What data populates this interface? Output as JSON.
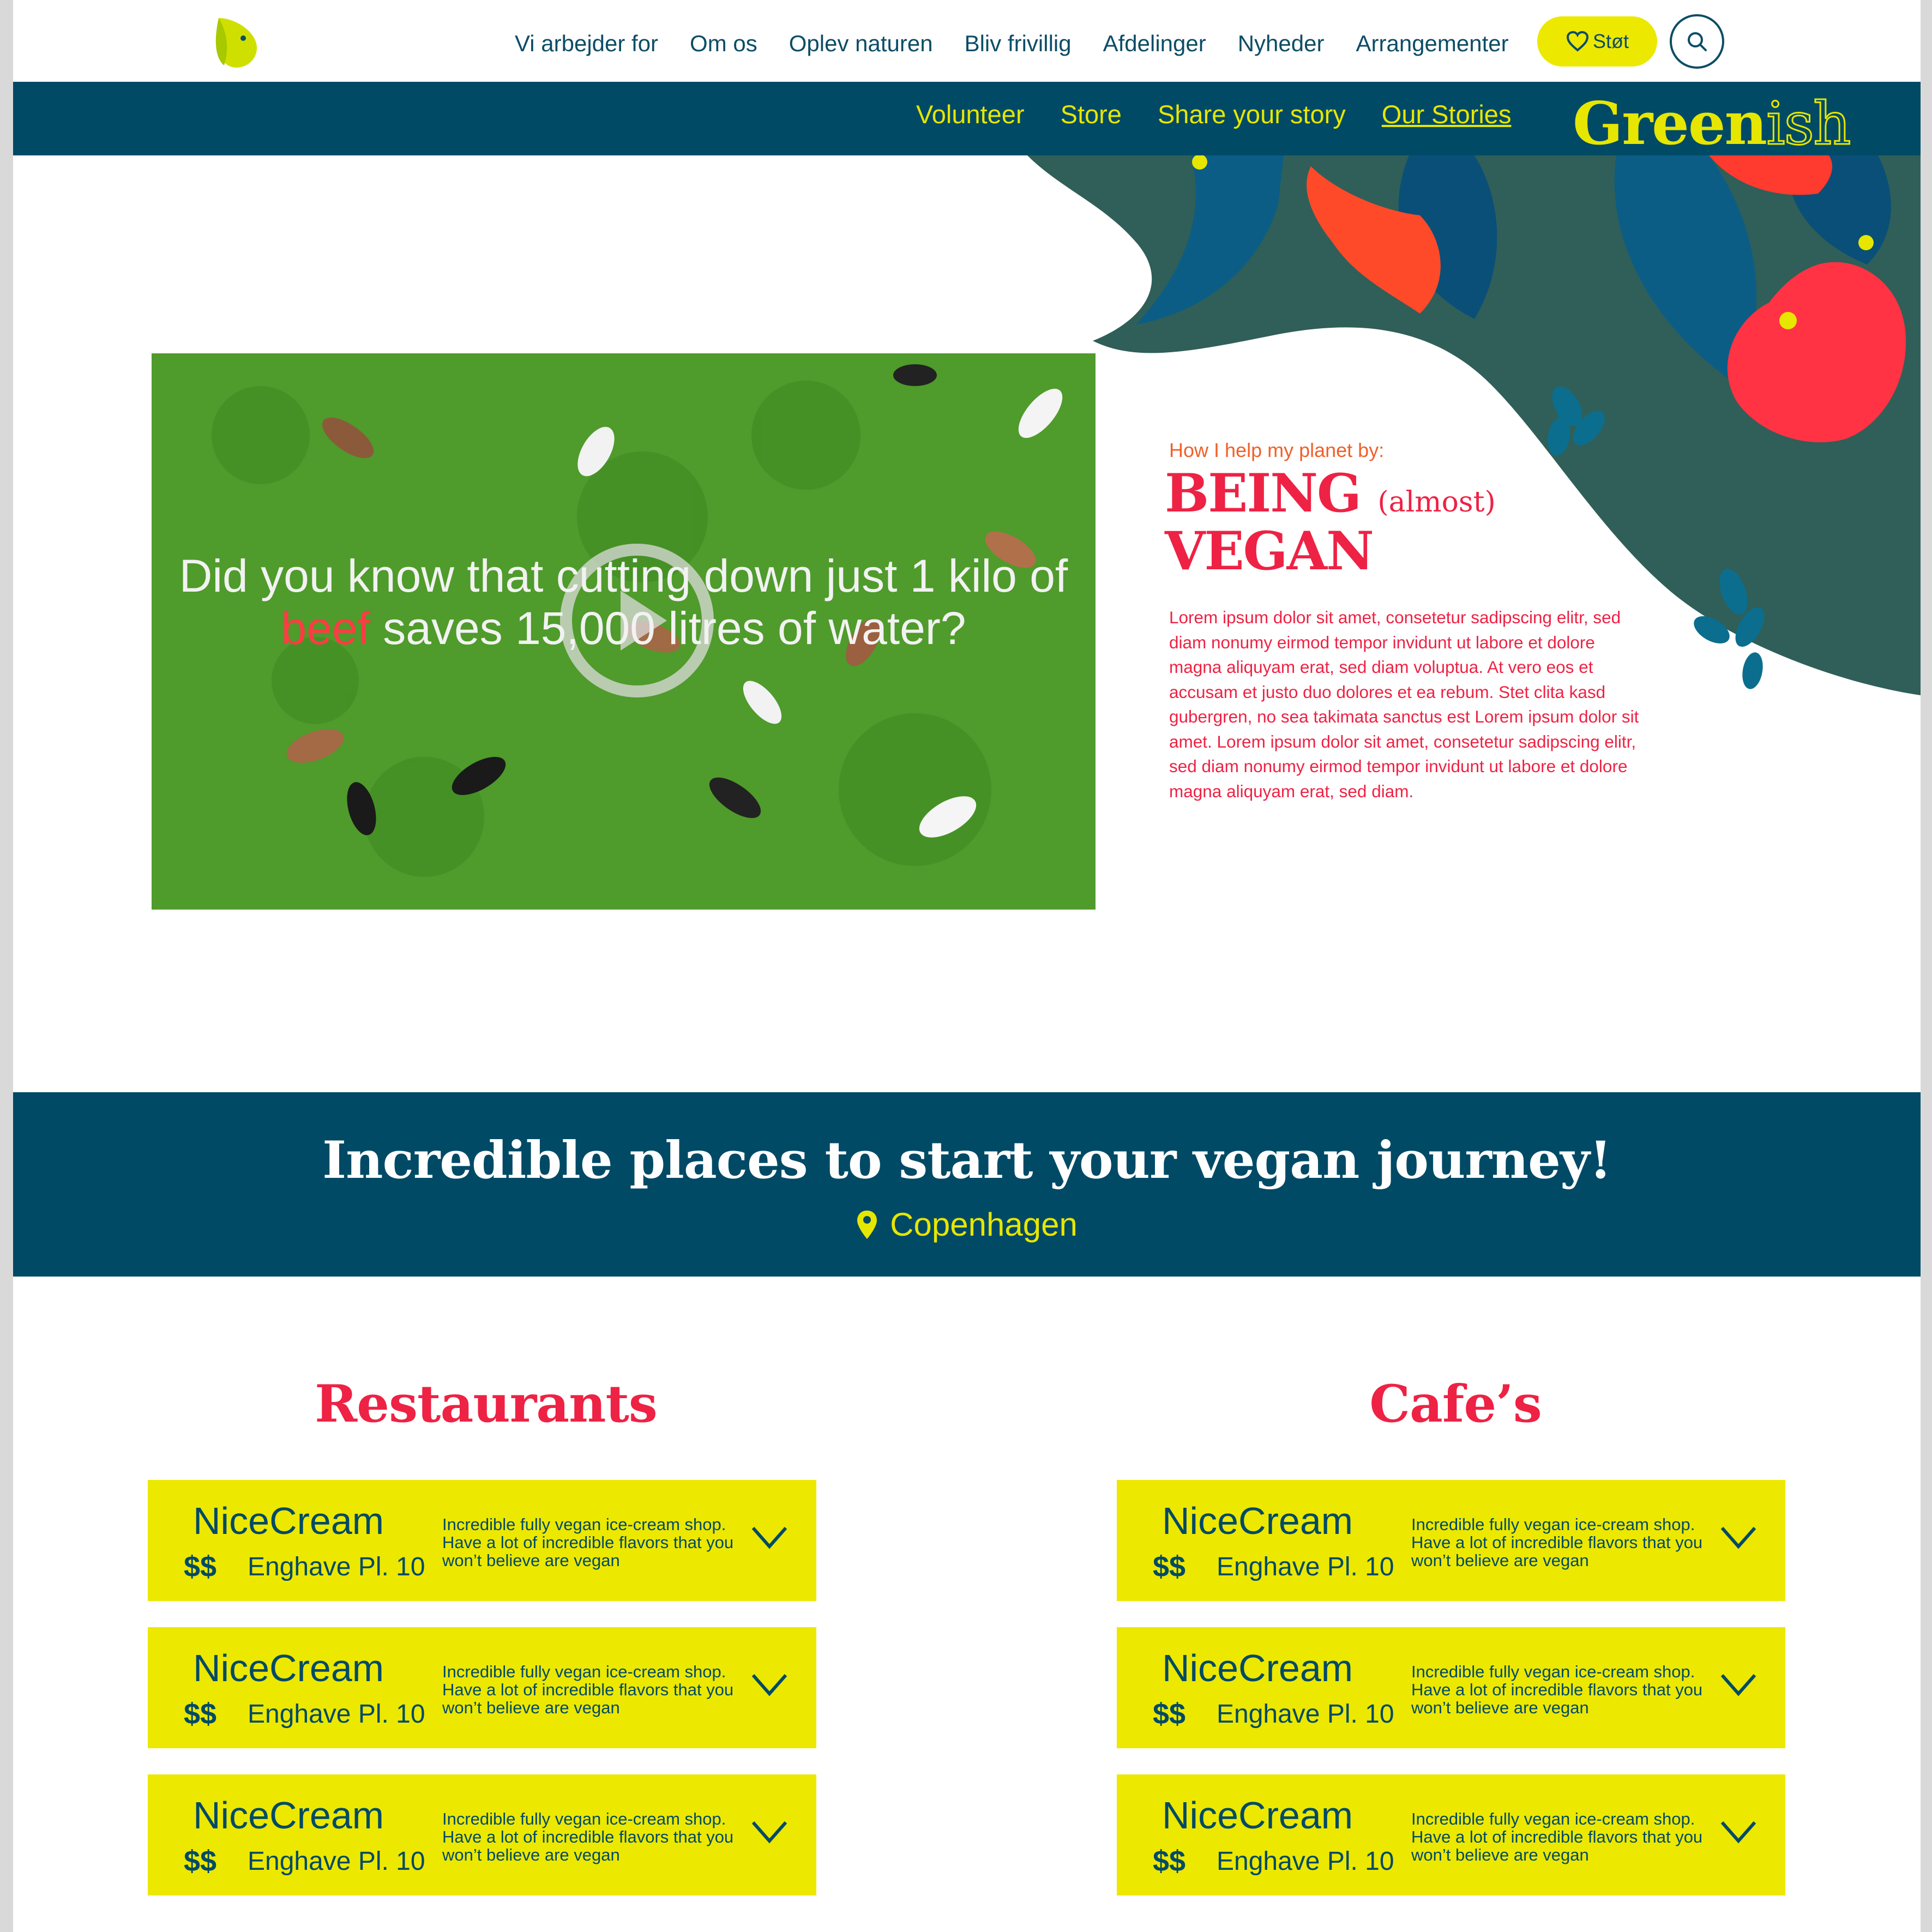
{
  "colors": {
    "navy": "#004a66",
    "yellow": "#ece800",
    "red": "#ee2244",
    "orange": "#f0602a"
  },
  "topnav": {
    "logo_icon": "butterfly-logo-icon",
    "links": [
      "Vi arbejder for",
      "Om os",
      "Oplev naturen",
      "Bliv frivillig",
      "Afdelinger",
      "Nyheder",
      "Arrangementer"
    ],
    "support_label": "Støt",
    "support_icon": "heart-icon",
    "search_icon": "search-icon"
  },
  "subnav": {
    "links": [
      "Volunteer",
      "Store",
      "Share your story",
      "Our Stories"
    ],
    "active": "Our Stories",
    "brand_main": "Green",
    "brand_suffix": "ish"
  },
  "video": {
    "caption_before": "Did you know that cutting down just 1 kilo of ",
    "caption_highlight": "beef",
    "caption_after": " saves 15,000 litres of water?",
    "play_icon": "play-icon"
  },
  "intro": {
    "kicker": "How I help my planet by:",
    "title_line1": "BEING",
    "title_small": "(almost)",
    "title_line2": "VEGAN",
    "body": "Lorem ipsum dolor sit amet, consetetur sadipscing elitr, sed diam nonumy eirmod tempor invidunt ut labore et dolore magna aliquyam erat, sed diam voluptua. At vero eos et accusam et justo duo dolores et ea rebum. Stet clita kasd gubergren, no sea takimata sanctus est Lorem ipsum dolor sit amet. Lorem ipsum dolor sit amet, consetetur sadipscing elitr, sed diam nonumy eirmod tempor invidunt ut labore et dolore magna aliquyam erat, sed diam."
  },
  "band": {
    "title": "Incredible places to start your vegan journey!",
    "location": "Copenhagen",
    "location_icon": "map-pin-icon"
  },
  "restaurants": {
    "title": "Restaurants",
    "items": [
      {
        "name": "NiceCream",
        "price": "$$",
        "address": "Enghave Pl. 10",
        "description": "Incredible fully vegan ice-cream shop. Have a lot of incredible flavors that you won’t believe are vegan"
      },
      {
        "name": "NiceCream",
        "price": "$$",
        "address": "Enghave Pl. 10",
        "description": "Incredible fully vegan ice-cream shop. Have a lot of incredible flavors that you won’t believe are vegan"
      },
      {
        "name": "NiceCream",
        "price": "$$",
        "address": "Enghave Pl. 10",
        "description": "Incredible fully vegan ice-cream shop. Have a lot of incredible flavors that you won’t believe are vegan"
      }
    ]
  },
  "cafes": {
    "title": "Cafe’s",
    "items": [
      {
        "name": "NiceCream",
        "price": "$$",
        "address": "Enghave Pl. 10",
        "description": "Incredible fully vegan ice-cream shop. Have a lot of incredible flavors that you won’t believe are vegan"
      },
      {
        "name": "NiceCream",
        "price": "$$",
        "address": "Enghave Pl. 10",
        "description": "Incredible fully vegan ice-cream shop. Have a lot of incredible flavors that you won’t believe are vegan"
      },
      {
        "name": "NiceCream",
        "price": "$$",
        "address": "Enghave Pl. 10",
        "description": "Incredible fully vegan ice-cream shop. Have a lot of incredible flavors that you won’t believe are vegan"
      }
    ]
  }
}
